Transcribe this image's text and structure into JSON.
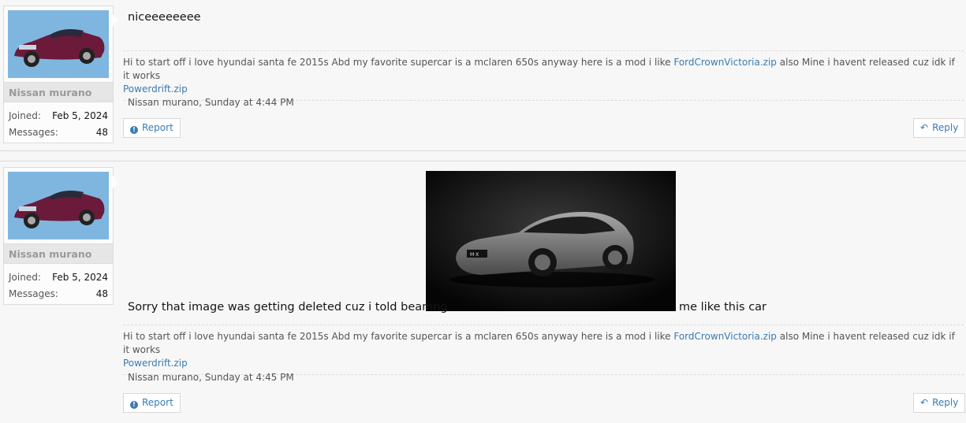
{
  "posts": [
    {
      "username": "Nissan murano",
      "joined_label": "Joined:",
      "joined_value": "Feb 5, 2024",
      "messages_label": "Messages:",
      "messages_value": "48",
      "message_text": "niceeeeeeee",
      "signature": {
        "text": "Hi to start off i love hyundai santa fe 2015s Abd my favorite supercar is a mclaren 650s anyway here is a mod i like",
        "link1": "FordCrownVictoria.zip",
        "middle": "also Mine i havent released cuz idk if it works",
        "link2": "Powerdrift.zip"
      },
      "meta": "Nissan murano, Sunday at 4:44 PM",
      "report_label": "Report",
      "reply_label": "Reply"
    },
    {
      "username": "Nissan murano",
      "joined_label": "Joined:",
      "joined_value": "Feb 5, 2024",
      "messages_label": "Messages:",
      "messages_value": "48",
      "message_before": "Sorry that image was getting deleted cuz i told beamng",
      "message_after": "me like this car",
      "signature": {
        "text": "Hi to start off i love hyundai santa fe 2015s Abd my favorite supercar is a mclaren 650s anyway here is a mod i like",
        "link1": "FordCrownVictoria.zip",
        "middle": "also Mine i havent released cuz idk if it works",
        "link2": "Powerdrift.zip"
      },
      "meta": "Nissan murano, Sunday at 4:45 PM",
      "report_label": "Report",
      "reply_label": "Reply"
    }
  ],
  "icons": {
    "report": "info-circle-icon",
    "reply": "reply-arrow-icon"
  },
  "colors": {
    "link": "#3a7bb3",
    "avatar_bg": "#7fb6e0",
    "car_body": "#6b1a3a"
  }
}
